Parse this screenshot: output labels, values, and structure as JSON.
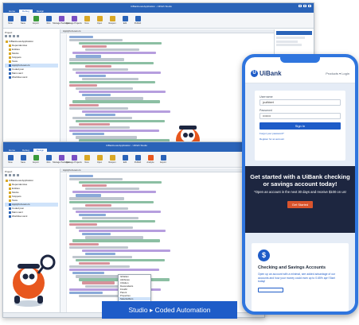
{
  "back_window": {
    "title": "UiBankLoanApplication - UiPath Studio",
    "tabs": [
      "Home",
      "Debug",
      "Design"
    ],
    "active_tab": "Debug",
    "ribbon": [
      "New",
      "Save",
      "Export",
      "Run",
      "Manage Packages",
      "Manage Projects",
      "New",
      "Open",
      "Reopen",
      "Edit",
      "Publish"
    ],
    "project_panel_title": "Project",
    "project_tree": [
      "UiBankLoanApplication",
      "Dependencies",
      "Entities",
      "Mocks",
      "Snippets",
      "Tests",
      "ApplyForLoan.cs",
      "Coded.json",
      "Main.xaml",
      "Workflow.xaml"
    ],
    "editor_tab": "ApplyForLoan.cs"
  },
  "front_window": {
    "title": "UiBankLoanApplication - UiPath Studio",
    "tabs": [
      "Home",
      "Debug",
      "Design"
    ],
    "active_tab": "Design",
    "ribbon": [
      "New",
      "Save",
      "Export",
      "Run",
      "Manage Packages",
      "Manage Projects",
      "New",
      "Open",
      "Reopen",
      "Edit",
      "Publish",
      "Analyze",
      "Export"
    ],
    "project_panel_title": "Project",
    "project_tree": [
      "UiBankLoanApplication",
      "Dependencies",
      "Entities",
      "Mocks",
      "Snippets",
      "Tests",
      "ApplyForLoan.cs",
      "Coded.json",
      "Main.xaml",
      "Workflow.xaml"
    ],
    "editor_tab": "ApplyForLoan.cs",
    "autocomplete": [
      "IsFlatten",
      "Attributes",
      "Children",
      "Descendants",
      "FindAll",
      "Parent",
      "Properties",
      "SelectedItem",
      "ToString"
    ]
  },
  "phone": {
    "brand": "UiBank",
    "nav": "Products ▾  Login",
    "login": {
      "username_label": "Username",
      "username_value": "jcuthbert",
      "password_label": "Password",
      "password_value": "••••••••",
      "signin_label": "Sign In",
      "forgot_label": "Forgot your password?",
      "register_label": "Register for an account"
    },
    "promo": {
      "heading": "Get started with a UiBank checking or savings account today!",
      "body": "*Open an account in the next 30 days and receive $100 on us!",
      "button": "Get Started"
    },
    "account": {
      "title": "Checking and Savings Accounts",
      "body": "Open up an account with a minimal, see added advantage of our accounts and how your money could earn up to 0.65% apr! Start today!"
    }
  },
  "banner": "Studio ▸ Coded Automation",
  "colors": {
    "studio_blue": "#2a63b8",
    "uibank_blue": "#1e5cc8",
    "promo_dark": "#1d2640",
    "phone_frame": "#2f75de",
    "robot_orange": "#e8571e"
  }
}
